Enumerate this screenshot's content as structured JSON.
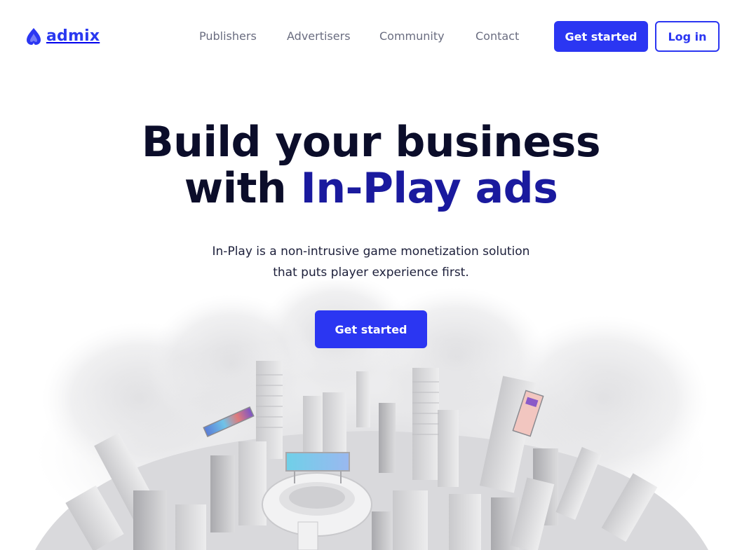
{
  "brand": {
    "name": "admix",
    "color": "#2b36f2"
  },
  "nav": {
    "links": [
      "Publishers",
      "Advertisers",
      "Community",
      "Contact"
    ],
    "get_started_label": "Get started",
    "login_label": "Log in"
  },
  "hero": {
    "title_line1": "Build your business",
    "title_line2_prefix": "with",
    "title_line2_accent": "In-Play ads",
    "subtitle_line1": "In-Play is a non-intrusive game monetization solution",
    "subtitle_line2": "that puts player experience first.",
    "cta_label": "Get started"
  },
  "colors": {
    "accent": "#2b36f2",
    "title": "#0b0d2a",
    "highlight": "#1a1a9e",
    "nav_text": "#6a6d80"
  }
}
